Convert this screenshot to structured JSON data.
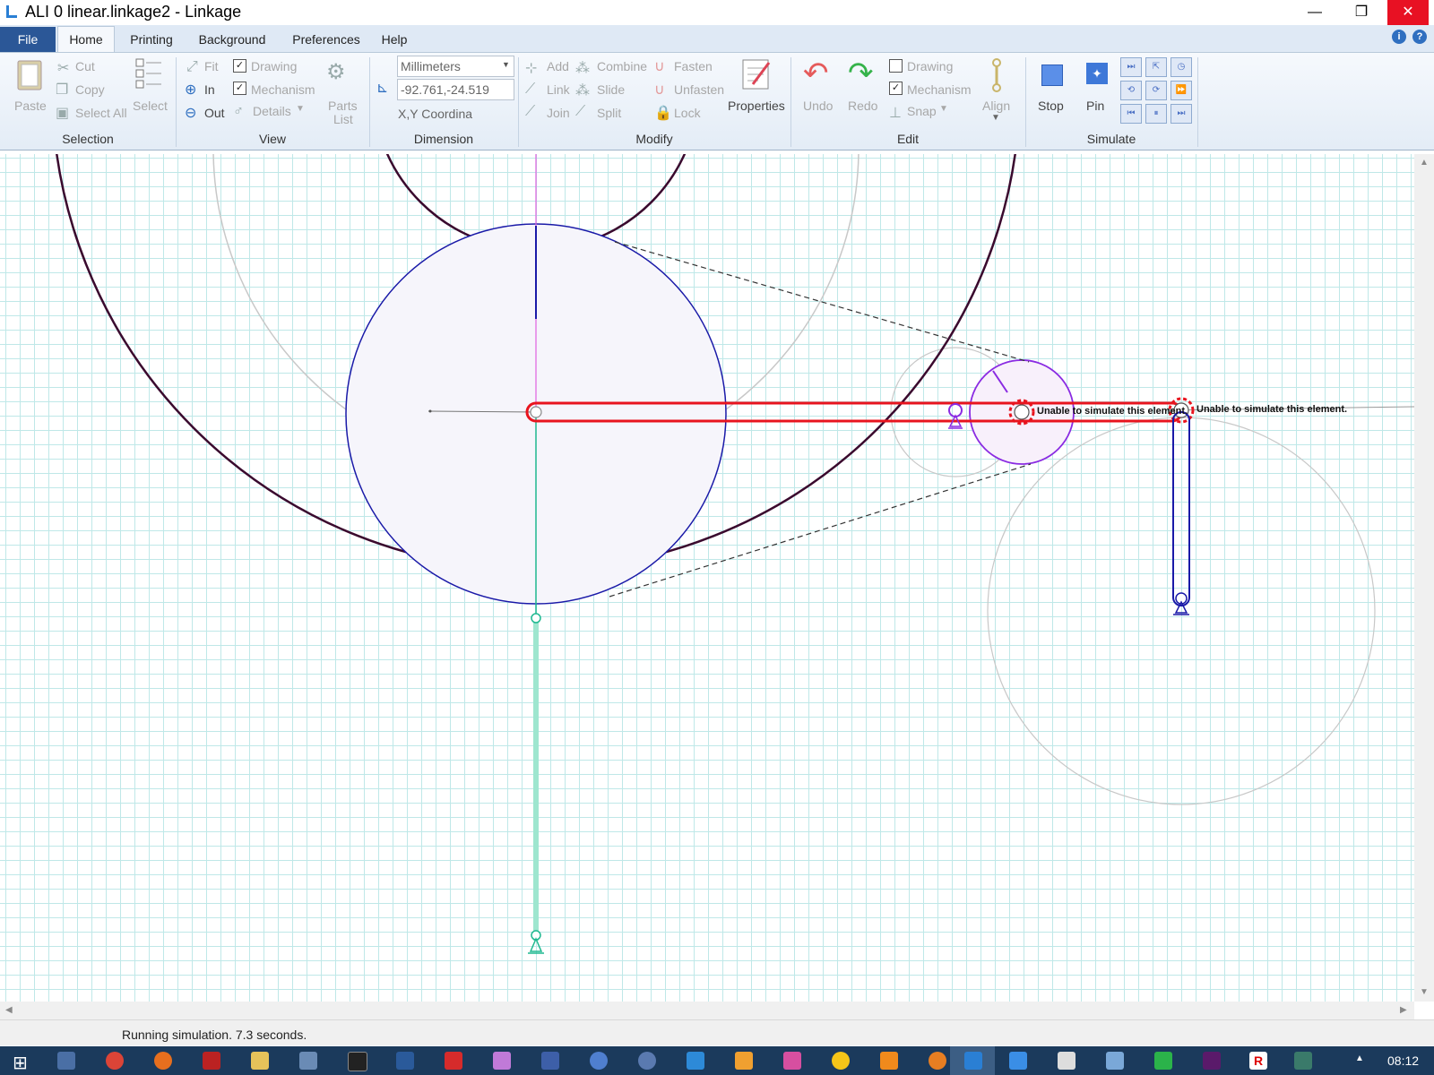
{
  "window": {
    "title": "ALI 0 linear.linkage2 - Linkage",
    "minimize": "—",
    "maximize": "❐",
    "close": "✕"
  },
  "tabs": [
    "File",
    "Home",
    "Printing",
    "Background",
    "Preferences",
    "Help"
  ],
  "ribbon": {
    "selection": {
      "paste": "Paste",
      "cut": "Cut",
      "copy": "Copy",
      "select_all": "Select All",
      "select": "Select",
      "label": "Selection"
    },
    "view": {
      "fit": "Fit",
      "in": "In",
      "out": "Out",
      "drawing": "Drawing",
      "mechanism": "Mechanism",
      "details": "Details",
      "parts_list_1": "Parts",
      "parts_list_2": "List",
      "label": "View"
    },
    "dimension": {
      "units": "Millimeters",
      "coordinates": "-92.761,-24.519",
      "xy_label": "X,Y Coordina",
      "label": "Dimension"
    },
    "modify": {
      "add": "Add",
      "link": "Link",
      "join": "Join",
      "combine": "Combine",
      "slide": "Slide",
      "split": "Split",
      "fasten": "Fasten",
      "unfasten": "Unfasten",
      "lock": "Lock",
      "properties": "Properties",
      "label": "Modify"
    },
    "edit": {
      "undo": "Undo",
      "redo": "Redo",
      "drawing": "Drawing",
      "mechanism": "Mechanism",
      "snap": "Snap",
      "align": "Align",
      "label": "Edit"
    },
    "simulate": {
      "stop": "Stop",
      "pin": "Pin",
      "label": "Simulate"
    }
  },
  "checkboxes": {
    "view_drawing": true,
    "view_mechanism": true,
    "edit_drawing": false,
    "edit_mechanism": true
  },
  "canvas": {
    "error_label_1": "Unable to simulate this element.",
    "error_label_2": "Unable to simulate this element."
  },
  "status": {
    "text": "Running simulation. 7.3 seconds."
  },
  "taskbar": {
    "clock": "08:12"
  },
  "colors": {
    "error": "#e8141e",
    "link_blue": "#1a1aa8",
    "gear_dark": "#3a0a2e",
    "teal": "#1fb890",
    "purple": "#8a2be2",
    "grid": "#bfe8e8"
  }
}
